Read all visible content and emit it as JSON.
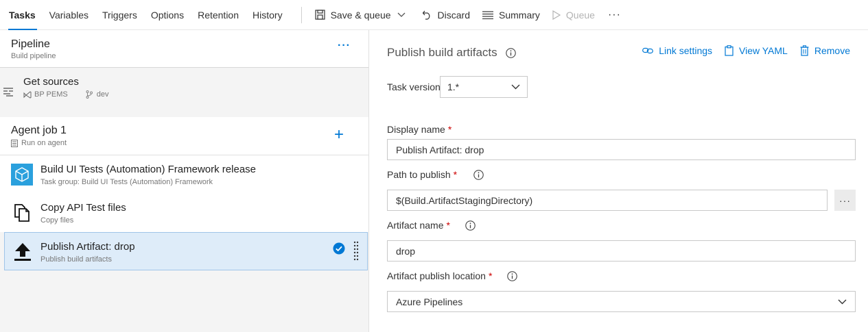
{
  "toolbar": {
    "tabs": [
      "Tasks",
      "Variables",
      "Triggers",
      "Options",
      "Retention",
      "History"
    ],
    "save_queue": "Save & queue",
    "discard": "Discard",
    "summary": "Summary",
    "queue": "Queue",
    "more": "···"
  },
  "pipeline": {
    "title": "Pipeline",
    "subtitle": "Build pipeline",
    "more": "···"
  },
  "sources": {
    "title": "Get sources",
    "repo": "BP PEMS",
    "branch": "dev"
  },
  "agent_job": {
    "title": "Agent job 1",
    "subtitle": "Run on agent",
    "add": "+"
  },
  "tasks": [
    {
      "title": "Build UI Tests (Automation) Framework release",
      "subtitle": "Task group: Build UI Tests (Automation) Framework"
    },
    {
      "title": "Copy API Test files",
      "subtitle": "Copy files"
    },
    {
      "title": "Publish Artifact: drop",
      "subtitle": "Publish build artifacts"
    }
  ],
  "details": {
    "title": "Publish build artifacts",
    "link_settings": "Link settings",
    "view_yaml": "View YAML",
    "remove": "Remove",
    "task_version_label": "Task version",
    "task_version_value": "1.*",
    "display_name_label": "Display name",
    "display_name_value": "Publish Artifact: drop",
    "path_label": "Path to publish",
    "path_value": "$(Build.ArtifactStagingDirectory)",
    "path_browse": "···",
    "artifact_name_label": "Artifact name",
    "artifact_name_value": "drop",
    "location_label": "Artifact publish location",
    "location_value": "Azure Pipelines",
    "required_mark": "*"
  },
  "colors": {
    "accent": "#0078d4",
    "selected_bg": "#deecf9",
    "required": "#cc0000"
  }
}
